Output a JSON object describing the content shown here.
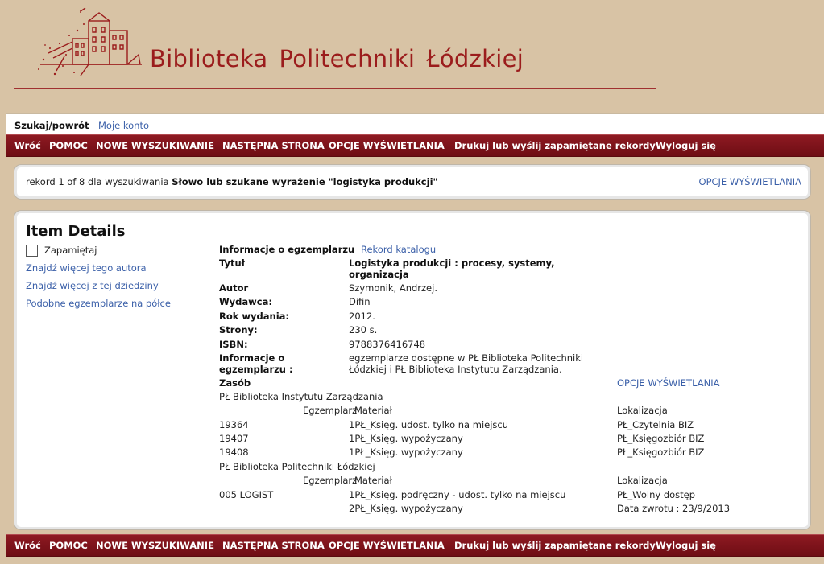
{
  "header": {
    "title_words": [
      "Biblioteka",
      "Politechniki",
      "Łódzkiej"
    ]
  },
  "tabs": {
    "active": "Szukaj/powrót",
    "link": "Moje konto"
  },
  "nav": {
    "items": [
      "Wróć",
      "POMOC",
      "NOWE WYSZUKIWANIE",
      "NASTĘPNA STRONA",
      "OPCJE WYŚWIETLANIA",
      "Drukuj lub wyślij zapamiętane rekordy",
      "Wyloguj się"
    ]
  },
  "search": {
    "record_prefix": "rekord 1 of 8 dla wyszukiwania",
    "query": "Słowo lub szukane wyrażenie \"logistyka produkcji\"",
    "display_options": "OPCJE WYŚWIETLANIA"
  },
  "details": {
    "title": "Item Details",
    "save_label": "Zapamiętaj",
    "links": [
      "Znajdź więcej tego autora",
      "Znajdź więcej z tej dziedziny",
      "Podobne egzemplarze na półce"
    ],
    "copy_info_label": "Informacje o egzemplarzu",
    "catalog_record_link": "Rekord katalogu",
    "fields": {
      "title_label": "Tytuł",
      "title_value_1": "Logistyka produkcji : procesy, systemy,",
      "title_value_2": "organizacja",
      "author_label": "Autor",
      "author_value": "Szymonik, Andrzej.",
      "publisher_label": "Wydawca:",
      "publisher_value": "Difin",
      "year_label": "Rok wydania:",
      "year_value": "2012.",
      "pages_label": "Strony:",
      "pages_value": "230 s.",
      "isbn_label": "ISBN:",
      "isbn_value": "9788376416748",
      "info_label_1": "Informacje o",
      "info_label_2": "egzemplarzu :",
      "info_value_1": "egzemplarze dostępne w PŁ Biblioteka Politechniki",
      "info_value_2": "Łódzkiej i PŁ Biblioteka Instytutu Zarządzania."
    },
    "holdings": {
      "label": "Zasób",
      "display_options": "OPCJE WYŚWIETLANIA",
      "libraries": [
        {
          "name": "PŁ Biblioteka Instytutu Zarządzania",
          "col_copy": "Egzemplarz",
          "col_material": "Materiał",
          "col_location": "Lokalizacja",
          "rows": [
            {
              "call": "19364",
              "material": "1PŁ_Księg. udost. tylko na miejscu",
              "location": "PŁ_Czytelnia BIZ"
            },
            {
              "call": "19407",
              "material": "1PŁ_Księg. wypożyczany",
              "location": "PŁ_Księgozbiór BIZ"
            },
            {
              "call": "19408",
              "material": "1PŁ_Księg. wypożyczany",
              "location": "PŁ_Księgozbiór BIZ"
            }
          ]
        },
        {
          "name": "PŁ Biblioteka Politechniki Łódzkiej",
          "col_copy": "Egzemplarz",
          "col_material": "Materiał",
          "col_location": "Lokalizacja",
          "rows": [
            {
              "call": "005 LOGIST",
              "material": "1PŁ_Księg. podręczny - udost. tylko na miejscu",
              "location": "PŁ_Wolny dostęp"
            },
            {
              "call": "",
              "material": "2PŁ_Księg. wypożyczany",
              "location": "Data zwrotu : 23/9/2013"
            }
          ]
        }
      ]
    }
  },
  "colors": {
    "page_bg": "#d8c3a5",
    "brand_red": "#9b1c1c",
    "nav_bg": "#7d121a",
    "link_blue": "#3a5fa8"
  }
}
